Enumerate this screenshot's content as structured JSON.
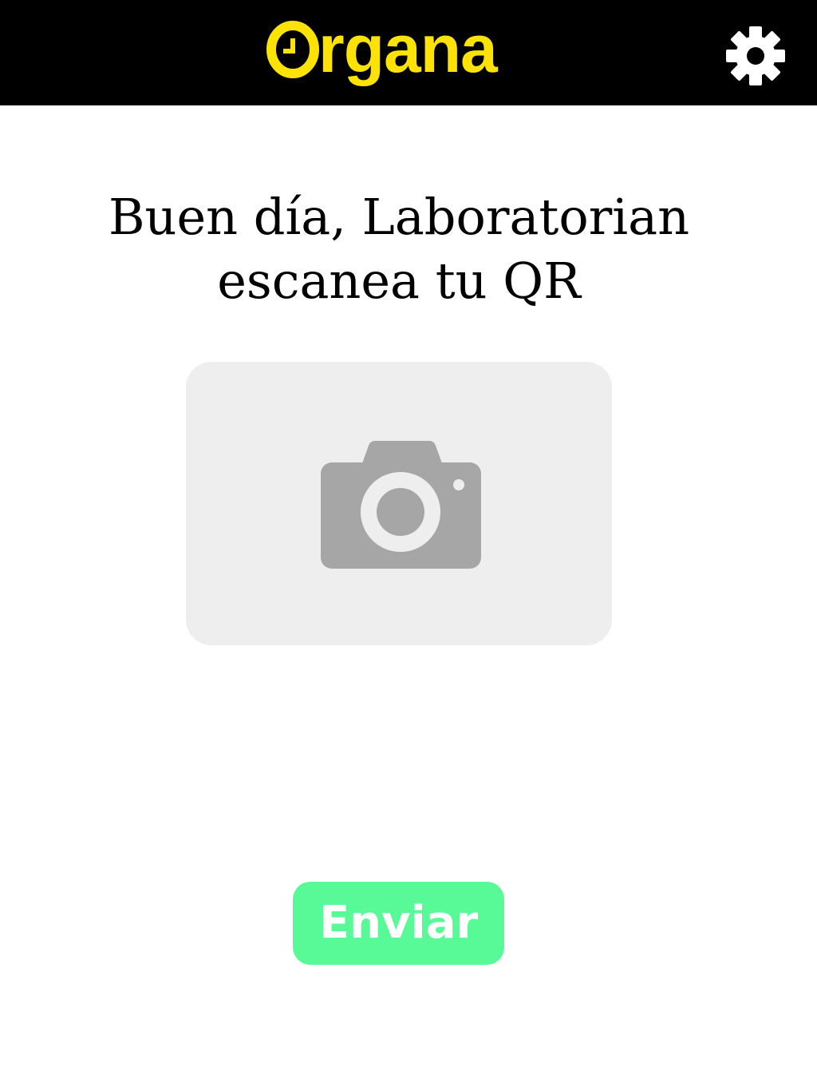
{
  "header": {
    "logo_text": "rgana",
    "logo_full": "Organa",
    "logo_icon": "clock-o-icon",
    "settings_icon": "gear-icon"
  },
  "main": {
    "greeting_line1": "Buen día, Laboratorian",
    "greeting_line2": "escanea tu QR",
    "camera_icon": "camera-icon"
  },
  "actions": {
    "send_label": "Enviar"
  },
  "colors": {
    "header_bg": "#000000",
    "brand_yellow": "#fce205",
    "camera_box_bg": "#eeeeee",
    "camera_icon": "#a6a6a6",
    "send_button_bg": "#58fa98",
    "send_button_text": "#ffffff"
  }
}
